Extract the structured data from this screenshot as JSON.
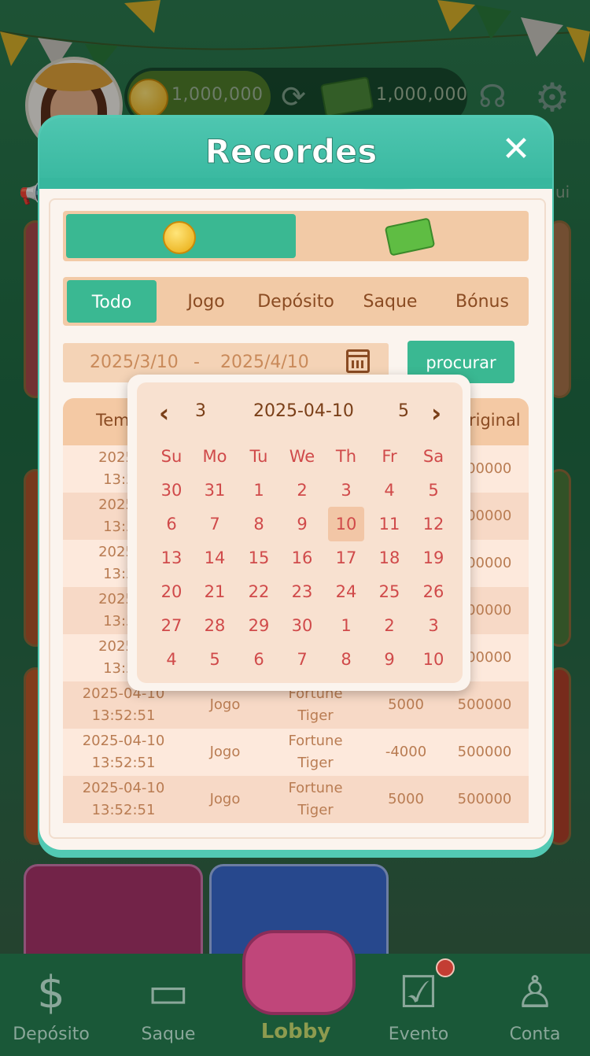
{
  "header": {
    "coins": "1,000,000",
    "cash": "1,000,000",
    "announcement_tail": "ui"
  },
  "modal": {
    "title": "Recordes",
    "close": "✕",
    "type_tabs": [
      "Todo",
      "Jogo",
      "Depósito",
      "Saque",
      "Bónus"
    ],
    "active_tab": "Todo",
    "date_from": "2025/3/10",
    "date_sep": "-",
    "date_to": "2025/4/10",
    "search_label": "procurar",
    "table": {
      "headers": [
        "Tem",
        "riginal"
      ],
      "rows": [
        {
          "date": "2025-0",
          "time": "13:52",
          "type": "",
          "game1": "",
          "game2": "",
          "amount": "",
          "balance": "500000"
        },
        {
          "date": "2025-0",
          "time": "13:52",
          "type": "",
          "game1": "",
          "game2": "",
          "amount": "",
          "balance": "500000"
        },
        {
          "date": "2025-0",
          "time": "13:52",
          "type": "",
          "game1": "",
          "game2": "",
          "amount": "",
          "balance": "500000"
        },
        {
          "date": "2025-0",
          "time": "13:52",
          "type": "",
          "game1": "",
          "game2": "",
          "amount": "",
          "balance": "500000"
        },
        {
          "date": "2025-0",
          "time": "13:52",
          "type": "",
          "game1": "",
          "game2": "",
          "amount": "",
          "balance": "500000"
        },
        {
          "date": "2025-04-10",
          "time": "13:52:51",
          "type": "Jogo",
          "game1": "Fortune",
          "game2": "Tiger",
          "amount": "5000",
          "balance": "500000"
        },
        {
          "date": "2025-04-10",
          "time": "13:52:51",
          "type": "Jogo",
          "game1": "Fortune",
          "game2": "Tiger",
          "amount": "-4000",
          "balance": "500000"
        },
        {
          "date": "2025-04-10",
          "time": "13:52:51",
          "type": "Jogo",
          "game1": "Fortune",
          "game2": "Tiger",
          "amount": "5000",
          "balance": "500000"
        }
      ]
    }
  },
  "picker": {
    "prev_month": "3",
    "current": "2025-04-10",
    "next_month": "5",
    "weekdays": [
      "Su",
      "Mo",
      "Tu",
      "We",
      "Th",
      "Fr",
      "Sa"
    ],
    "weeks": [
      [
        "30",
        "31",
        "1",
        "2",
        "3",
        "4",
        "5"
      ],
      [
        "6",
        "7",
        "8",
        "9",
        "10",
        "11",
        "12"
      ],
      [
        "13",
        "14",
        "15",
        "16",
        "17",
        "18",
        "19"
      ],
      [
        "20",
        "21",
        "22",
        "23",
        "24",
        "25",
        "26"
      ],
      [
        "27",
        "28",
        "29",
        "30",
        "1",
        "2",
        "3"
      ],
      [
        "4",
        "5",
        "6",
        "7",
        "8",
        "9",
        "10"
      ]
    ],
    "selected_day": "10"
  },
  "nav": {
    "items": [
      "Depósito",
      "Saque",
      "Lobby",
      "Evento",
      "Conta"
    ]
  },
  "colors": {
    "accent": "#3ab892",
    "modal_bg": "#fbf4ee",
    "tab_bg": "#f2caa6",
    "day_text": "#d04a4a"
  }
}
